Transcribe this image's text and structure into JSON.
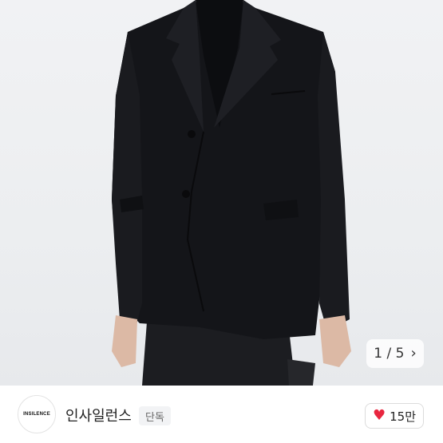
{
  "gallery": {
    "current": "1",
    "separator": "/",
    "total": "5",
    "next_icon": "chevron-right-icon"
  },
  "brand": {
    "logo_text": "INSILENCE",
    "name": "인사일런스",
    "badge": "단독"
  },
  "like": {
    "icon": "heart-icon",
    "count": "15만",
    "color": "#e8263f"
  },
  "colors": {
    "jacket": "#141519",
    "background": "#eef0f2"
  }
}
